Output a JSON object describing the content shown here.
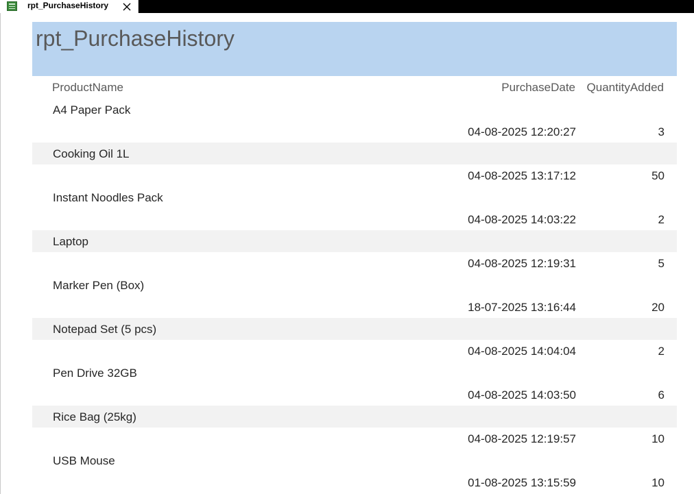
{
  "window": {
    "tab_title": "rpt_PurchaseHistory"
  },
  "report": {
    "title": "rpt_PurchaseHistory",
    "columns": {
      "product": "ProductName",
      "date": "PurchaseDate",
      "qty": "QuantityAdded"
    },
    "rows": [
      {
        "product": "A4 Paper Pack",
        "date": "04-08-2025 12:20:27",
        "qty": "3"
      },
      {
        "product": "Cooking Oil 1L",
        "date": "04-08-2025 13:17:12",
        "qty": "50"
      },
      {
        "product": "Instant Noodles Pack",
        "date": "04-08-2025 14:03:22",
        "qty": "2"
      },
      {
        "product": "Laptop",
        "date": "04-08-2025 12:19:31",
        "qty": "5"
      },
      {
        "product": "Marker Pen (Box)",
        "date": "18-07-2025 13:16:44",
        "qty": "20"
      },
      {
        "product": "Notepad Set (5 pcs)",
        "date": "04-08-2025 14:04:04",
        "qty": "2"
      },
      {
        "product": "Pen Drive 32GB",
        "date": "04-08-2025 14:03:50",
        "qty": "6"
      },
      {
        "product": "Rice Bag (25kg)",
        "date": "04-08-2025 12:19:57",
        "qty": "10"
      },
      {
        "product": "USB Mouse",
        "date": "01-08-2025 13:15:59",
        "qty": "10"
      }
    ]
  },
  "icons": {
    "tab_icon": "report-icon",
    "close": "close-icon"
  },
  "colors": {
    "header_band": "#b9d4f0",
    "alt_row": "#f2f2f2",
    "tab_bar": "#000000",
    "icon_green": "#3c8a3c"
  }
}
